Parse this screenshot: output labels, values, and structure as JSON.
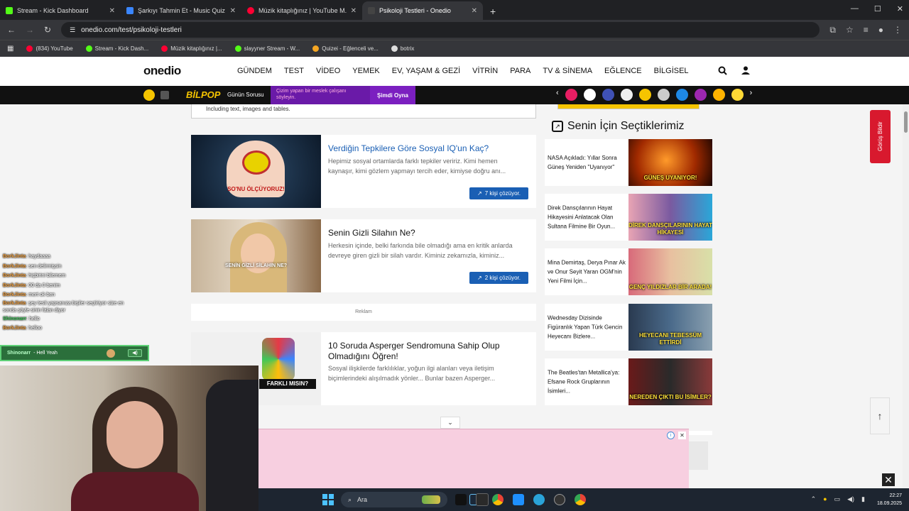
{
  "browser": {
    "tabs": [
      {
        "title": "Stream - Kick Dashboard",
        "color": "#53fc18"
      },
      {
        "title": "Şarkıyı Tahmin Et - Music Quiz",
        "color": "#3a86ff"
      },
      {
        "title": "Müzik kitaplığınız | YouTube M...",
        "color": "#ff0033"
      },
      {
        "title": "Psikoloji Testleri - Onedio",
        "color": "#444444"
      }
    ],
    "address": "onedio.com/test/psikoloji-testleri",
    "bookmarks": [
      {
        "label": "(834) YouTube",
        "color": "#ff0033"
      },
      {
        "label": "Stream - Kick Dash...",
        "color": "#53fc18"
      },
      {
        "label": "Müzik kitaplığınız |...",
        "color": "#ff0033"
      },
      {
        "label": "slayyner Stream - W...",
        "color": "#53fc18"
      },
      {
        "label": "Quizei - Eğlenceli ve...",
        "color": "#f5a623"
      },
      {
        "label": "botrix",
        "color": "#dddddd"
      }
    ]
  },
  "site": {
    "logo": "onedio",
    "nav": [
      "GÜNDEM",
      "TEST",
      "VİDEO",
      "YEMEK",
      "EV, YAŞAM & GEZİ",
      "VİTRİN",
      "PARA",
      "TV & SİNEMA",
      "EĞLENCE",
      "BİLGİSEL"
    ],
    "bilpop": "BİLPOP",
    "gunun_sorusu": "Günün Sorusu",
    "promo_text": "Çizim yapan bir meslek çalışanı söyleyin.",
    "simdi_oyna": "Şimdi Oyna",
    "prev_box_text": "Including text, images and tables.",
    "reklam": "Reklam",
    "articles": [
      {
        "title": "Verdiğin Tepkilere Göre Sosyal IQ'un Kaç?",
        "desc": "Hepimiz sosyal ortamlarda farklı tepkiler veririz. Kimi hemen kaynaşır, kimi gözlem yapmayı tercih eder, kimiyse doğru anı...",
        "solvers": "7 kişi çözüyor.",
        "thumb_caption": "SO'NU ÖLÇÜYORUZ!"
      },
      {
        "title": "Senin Gizli Silahın Ne?",
        "desc": "Herkesin içinde, belki farkında bile olmadığı ama en kritik anlarda devreye giren gizli bir silah vardır. Kiminiz zekamızla, kiminiz...",
        "solvers": "2 kişi çözüyor.",
        "thumb_caption": "SENİN GİZLİ SİLAHIN NE?"
      },
      {
        "title": "10 Soruda Asperger Sendromuna Sahip Olup Olmadığını Öğren!",
        "desc": "Sosyal ilişkilerde farklılıklar, yoğun ilgi alanları veya iletişim biçimlerindeki alışılmadık yönler... Bunlar bazen Asperger...",
        "thumb_caption": "FARKLI MISIN?"
      }
    ],
    "sidebar": {
      "title": "Senin İçin Seçtiklerimiz",
      "items": [
        {
          "text": "NASA Açıkladı: Yıllar Sonra Güneş Yeniden \"Uyanıyor\"",
          "caption": "GÜNEŞ UYANIYOR!",
          "bg": "#2a0d00"
        },
        {
          "text": "Direk Dansçılarının Hayat Hikayesini Anlatacak Olan Sultana Filmine Bir Oyun...",
          "caption": "DİREK DANSÇILARININ HAYAT HİKAYESİ",
          "bg": "#6a3a8a"
        },
        {
          "text": "Mina Demirtaş, Derya Pınar Ak ve Onur Seyit Yaran OGM'nin Yeni Filmi İçin...",
          "caption": "GENÇ YILDIZLAR BİR ARADA!",
          "bg": "#b76f6f"
        },
        {
          "text": "Wednesday Dizisinde Figüranlık Yapan Türk Gencin Heyecanı Bizlere...",
          "caption": "HEYECANI TEBESSÜM ETTİRDİ",
          "bg": "#1f2b3a"
        },
        {
          "text": "The Beatles'tan Metallica'ya: Efsane Rock Gruplarının İsimleri...",
          "caption": "NEREDEN ÇIKTI BU İSİMLER?",
          "bg": "#3a1a1a"
        }
      ]
    },
    "feedback": "Görüş Bildir"
  },
  "chat": {
    "lines": [
      {
        "user": "BorkJinta",
        "msg": ": haydaaaa"
      },
      {
        "user": "BorkJinta",
        "msg": ": sen delirmişsin"
      },
      {
        "user": "BorkJinta",
        "msg": ": hiçbirini bilemem"
      },
      {
        "user": "BorkJinta",
        "msg": ": 00 da 0 benim"
      },
      {
        "user": "BorkJinta",
        "msg": ": mert ok ben"
      },
      {
        "user": "BorkJinta",
        "msg": ": şey testi yapsanıza bişiler seçtiriyor size en"
      },
      {
        "user": "",
        "msg": "sonda şöyle sinin falan diyor"
      },
      {
        "user": "Shinonarr",
        "msg": ": hello",
        "mod": true
      },
      {
        "user": "BorkJinta",
        "msg": ": helloo"
      }
    ],
    "highlight_user": "Shinonarr",
    "highlight_msg": "- Hell Yeah"
  },
  "taskbar": {
    "search": "Ara",
    "time": "22:27",
    "date": "18.09.2025"
  }
}
